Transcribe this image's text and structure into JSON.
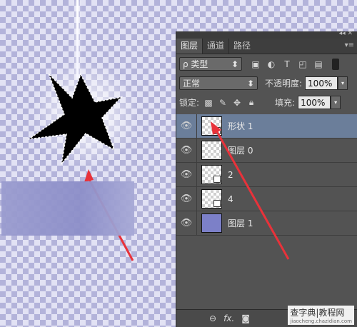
{
  "canvas": {
    "shape_color": "#000000",
    "arrow_color": "#e8323a",
    "rect_color": "#8f91cb"
  },
  "panel": {
    "tabs": [
      "图层",
      "通道",
      "路径"
    ],
    "filter": {
      "label": "ρ 类型"
    },
    "filter_icons": [
      "image-icon",
      "adjustment-icon",
      "text-icon",
      "shape-icon",
      "smart-object-icon"
    ],
    "blend_mode": "正常",
    "opacity_label": "不透明度:",
    "opacity_value": "100%",
    "lock_label": "锁定:",
    "fill_label": "填充:",
    "fill_value": "100%",
    "layers": [
      {
        "name": "形状 1",
        "selected": true,
        "thumb": "shape"
      },
      {
        "name": "图层 0",
        "selected": false,
        "thumb": "transparent"
      },
      {
        "name": "2",
        "selected": false,
        "thumb": "smart"
      },
      {
        "name": "4",
        "selected": false,
        "thumb": "smart"
      },
      {
        "name": "图层 1",
        "selected": false,
        "thumb": "solid"
      }
    ],
    "footer_icons": [
      "link-icon",
      "fx-icon",
      "mask-icon"
    ],
    "fx_label": "fx."
  },
  "watermark": {
    "title": "查字典|教程网",
    "url": "jiaocheng.chazidian.com"
  }
}
